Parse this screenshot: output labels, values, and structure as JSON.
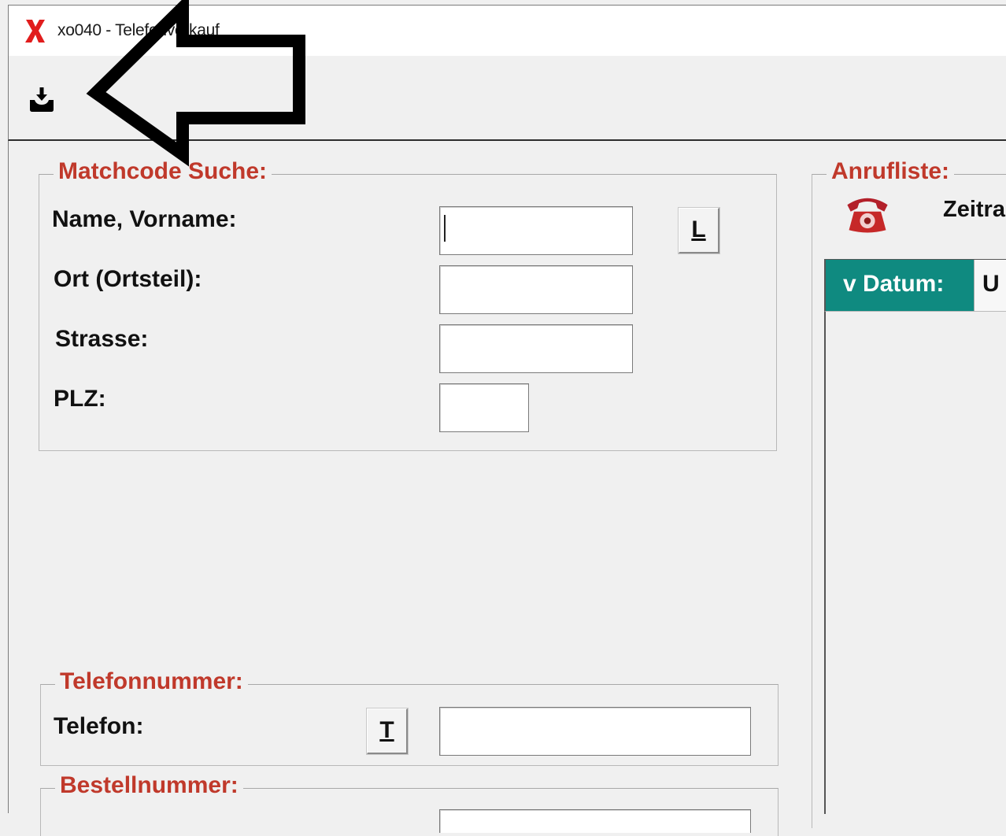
{
  "window": {
    "title": "xo040 - Telefonverkauf",
    "logo_color": "#e11d1d"
  },
  "toolbar": {
    "download_icon": "download-tray-icon"
  },
  "matchcode": {
    "legend": "Matchcode Suche:",
    "name_label": "Name, Vorname:",
    "ort_label": "Ort (Ortsteil):",
    "strasse_label": "Strasse:",
    "plz_label": "PLZ:",
    "name_value": "",
    "ort_value": "",
    "strasse_value": "",
    "plz_value": "",
    "l_button": "L"
  },
  "telefonnummer": {
    "legend": "Telefonnummer:",
    "telefon_label": "Telefon:",
    "t_button": "T",
    "telefon_value": ""
  },
  "bestellnummer": {
    "legend": "Bestellnummer:"
  },
  "anrufliste": {
    "legend": "Anrufliste:",
    "zeitraum_label": "Zeitra",
    "phone_icon": "telephone-icon",
    "columns": [
      "v Datum:",
      "U"
    ]
  },
  "colors": {
    "accent_red": "#c0392b",
    "header_teal": "#0f8a80"
  }
}
